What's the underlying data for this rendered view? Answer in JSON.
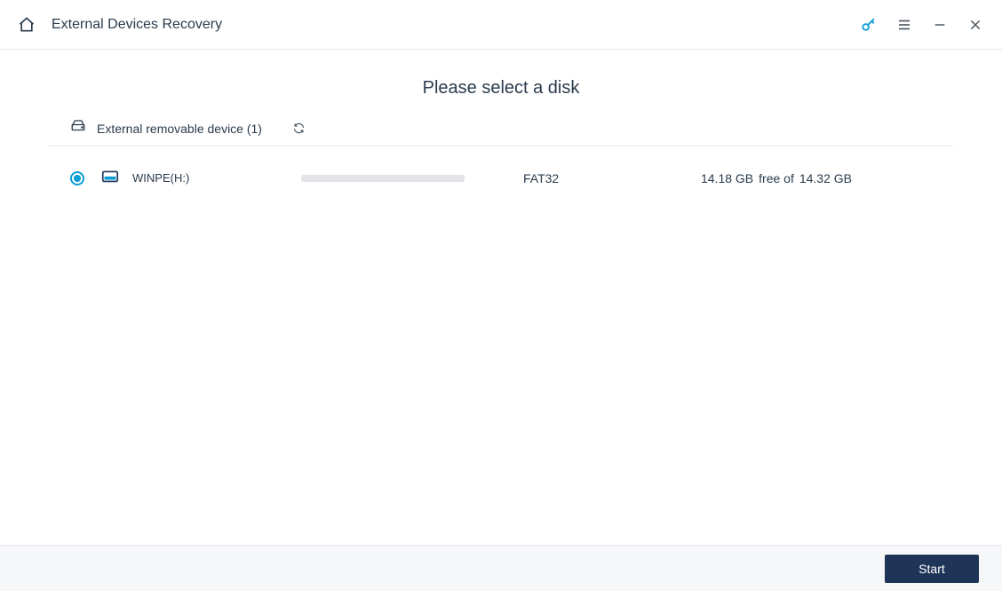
{
  "titlebar": {
    "title": "External Devices Recovery"
  },
  "main": {
    "prompt": "Please select a disk",
    "category_label": "External removable device (1)"
  },
  "disk": {
    "name": "WINPE(H:)",
    "fs": "FAT32",
    "free": "14.18 GB",
    "free_label": "free of",
    "total": "14.32 GB"
  },
  "footer": {
    "start_label": "Start"
  }
}
